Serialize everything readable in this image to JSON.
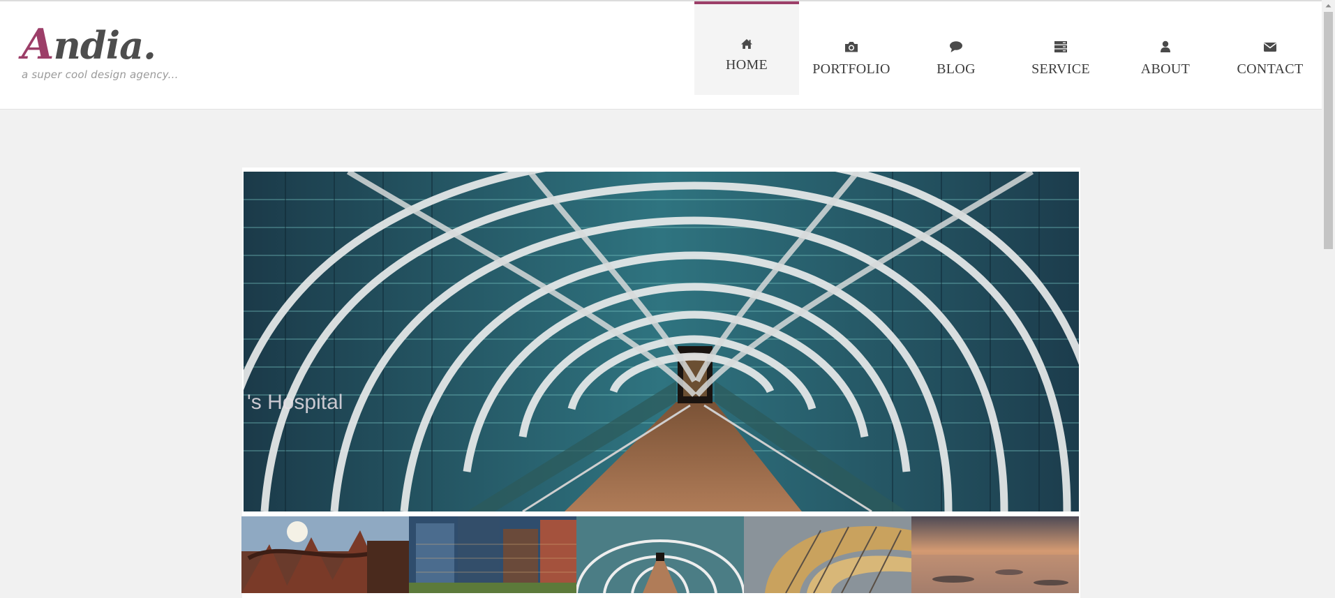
{
  "brand": {
    "initial": "A",
    "name_rest": "ndia.",
    "tagline": "a super cool design agency...",
    "accent_color": "#9c3e68"
  },
  "nav": {
    "items": [
      {
        "label": "HOME",
        "icon": "home-icon",
        "active": true
      },
      {
        "label": "PORTFOLIO",
        "icon": "camera-icon",
        "active": false
      },
      {
        "label": "BLOG",
        "icon": "comment-icon",
        "active": false
      },
      {
        "label": "SERVICE",
        "icon": "server-icon",
        "active": false
      },
      {
        "label": "ABOUT",
        "icon": "user-icon",
        "active": false
      },
      {
        "label": "CONTACT",
        "icon": "envelope-icon",
        "active": false
      }
    ]
  },
  "slider": {
    "main_image": "glass-walkway-bridge-photo",
    "main_image_sign_text": "'s Hospital",
    "thumbnails": [
      {
        "name": "tree-sculpture-photo"
      },
      {
        "name": "skyscrapers-photo"
      },
      {
        "name": "glass-walkway-photo",
        "active": true
      },
      {
        "name": "spiral-staircase-photo"
      },
      {
        "name": "sunset-beach-photo"
      }
    ]
  }
}
